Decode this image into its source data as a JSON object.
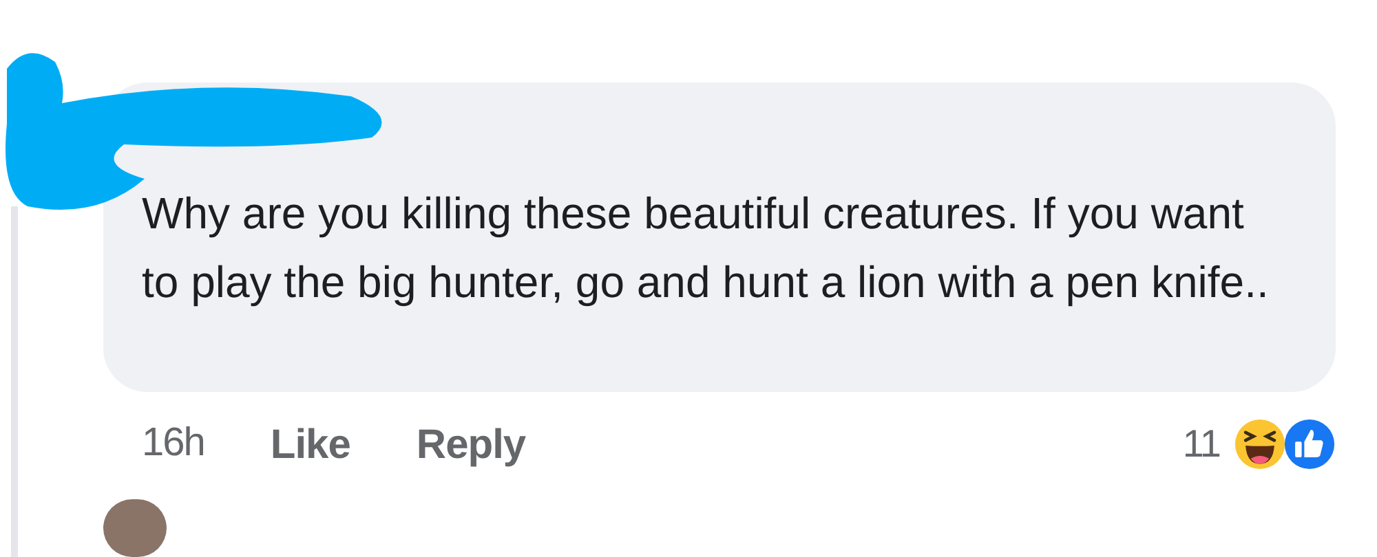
{
  "comment": {
    "text": "Why are you killing these beautiful creatures. If you want to play the big hunter, go and hunt a lion with a pen knife..",
    "time": "16h",
    "actions": [
      "Like",
      "Reply"
    ],
    "reaction_count": "11"
  }
}
